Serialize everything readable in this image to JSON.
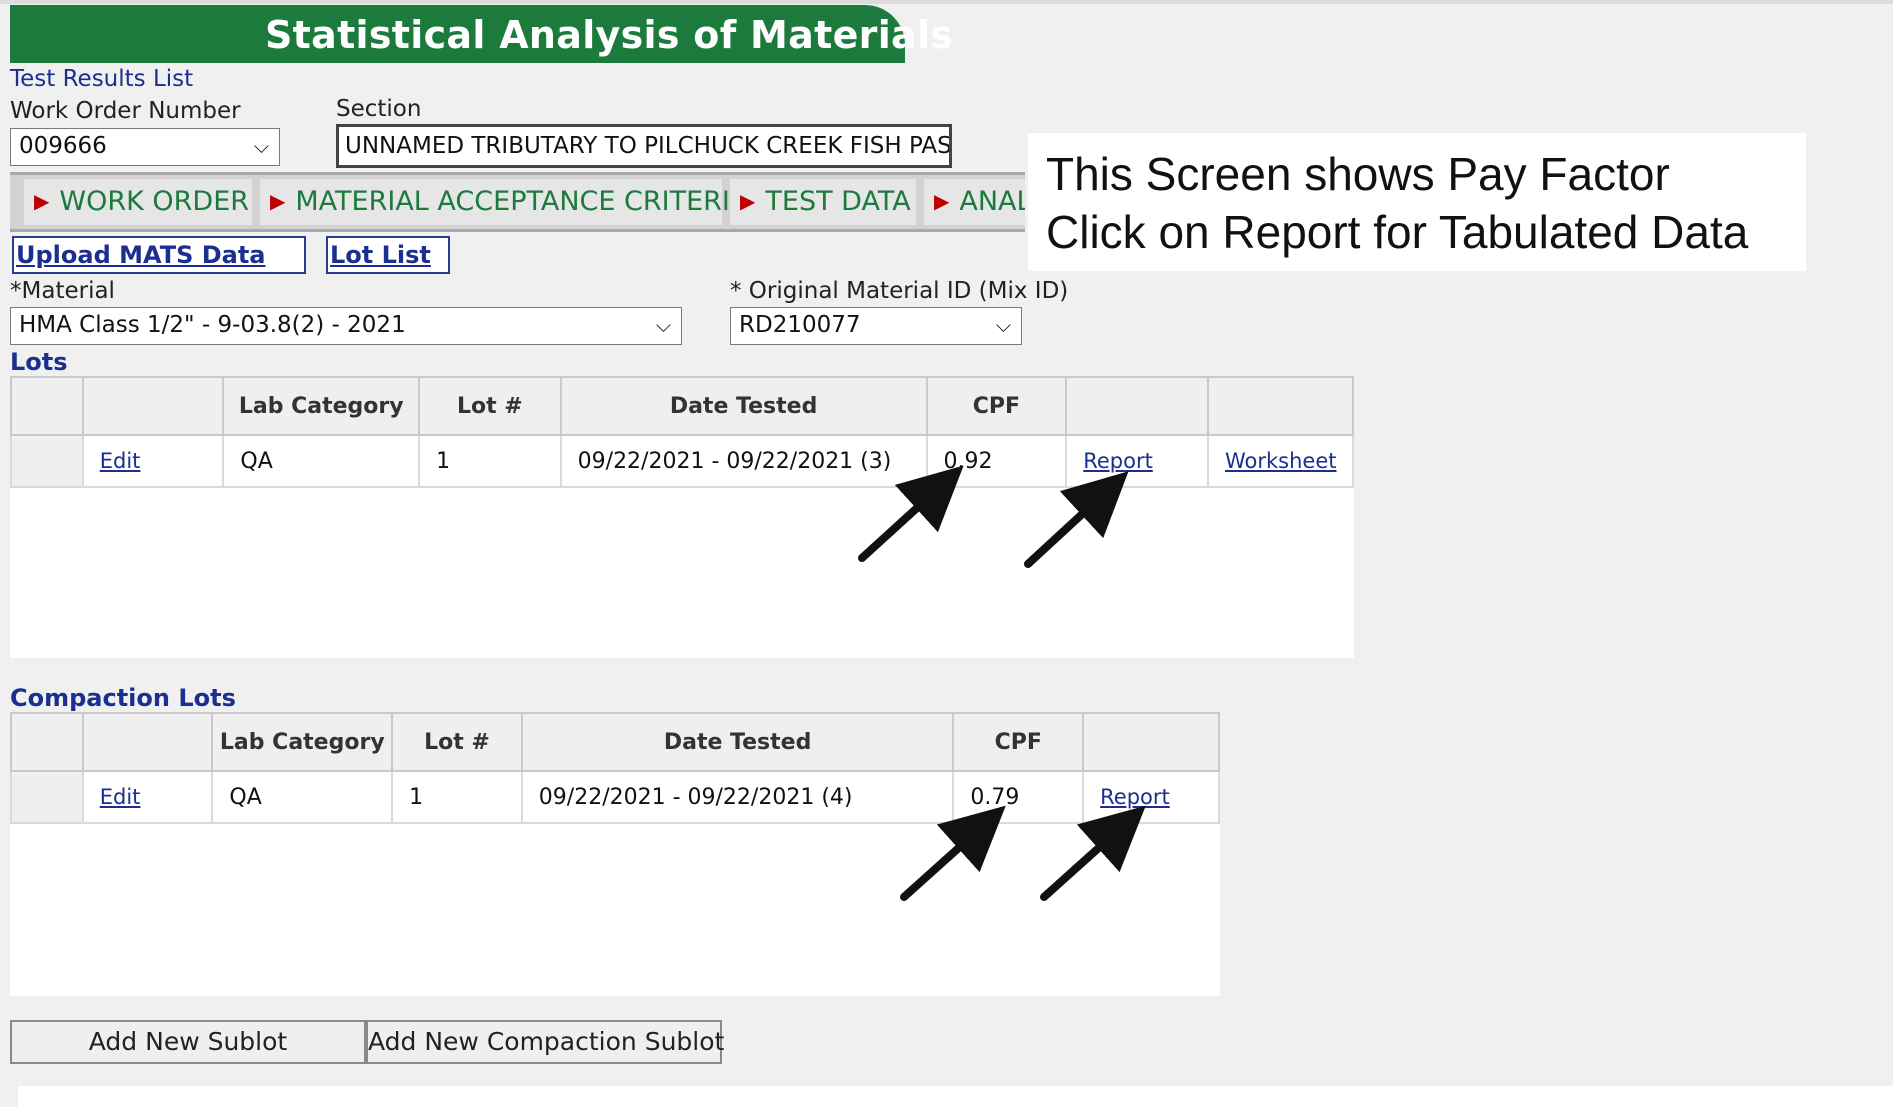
{
  "header": {
    "title": "Statistical Analysis of Materials"
  },
  "nav": {
    "test_results_list": "Test Results List"
  },
  "work_order": {
    "label": "Work Order Number",
    "value": "009666"
  },
  "section": {
    "label": "Section",
    "value": "UNNAMED TRIBUTARY TO PILCHUCK CREEK FISH PASSA"
  },
  "tabs": [
    {
      "label": "WORK ORDER"
    },
    {
      "label": "MATERIAL ACCEPTANCE CRITERIA"
    },
    {
      "label": "TEST DATA"
    },
    {
      "label": "ANAL"
    }
  ],
  "callout": {
    "line1": "This Screen shows Pay Factor",
    "line2": "Click on Report for Tabulated Data"
  },
  "links": {
    "upload_mats": "Upload MATS Data",
    "lot_list": "Lot List"
  },
  "material": {
    "label": "*Material",
    "value": "HMA Class 1/2\" - 9-03.8(2) - 2021"
  },
  "mix_id": {
    "label": "* Original Material ID (Mix ID)",
    "value": "RD210077"
  },
  "lots": {
    "heading": "Lots",
    "columns": [
      "Lab Category",
      "Lot #",
      "Date Tested",
      "CPF"
    ],
    "rows": [
      {
        "edit": "Edit",
        "lab_category": "QA",
        "lot": "1",
        "date_tested": "09/22/2021 - 09/22/2021 (3)",
        "cpf": "0.92",
        "report": "Report",
        "worksheet": "Worksheet"
      }
    ]
  },
  "compaction_lots": {
    "heading": "Compaction Lots",
    "columns": [
      "Lab Category",
      "Lot #",
      "Date Tested",
      "CPF"
    ],
    "rows": [
      {
        "edit": "Edit",
        "lab_category": "QA",
        "lot": "1",
        "date_tested": "09/22/2021 - 09/22/2021 (4)",
        "cpf": "0.79",
        "report": "Report"
      }
    ]
  },
  "buttons": {
    "add_sublot": "Add New Sublot",
    "add_compaction_sublot": "Add New Compaction Sublot"
  },
  "icons": [
    "chevron-down-icon",
    "play-triangle-icon",
    "arrow-pointer-icon"
  ],
  "colors": {
    "banner": "#1b7a3c",
    "link": "#1a2f8f",
    "tab_text": "#1b7a3c",
    "tab_marker": "#c00000"
  }
}
